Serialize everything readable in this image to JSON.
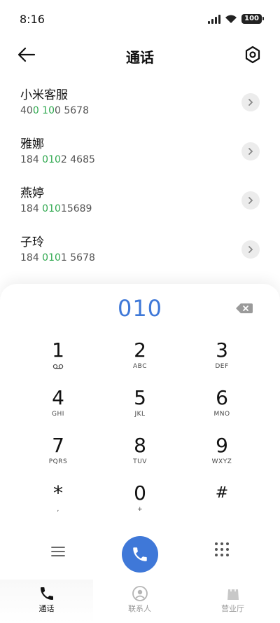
{
  "status_bar": {
    "time": "8:16",
    "battery": "100"
  },
  "header": {
    "title": "通话",
    "back_icon": "arrow-left-icon",
    "settings_icon": "gear-hexagon-icon"
  },
  "contacts": [
    {
      "name": "小米客服",
      "number_parts": [
        "40",
        "0 10",
        "0 5678"
      ]
    },
    {
      "name": "雅娜",
      "number_parts": [
        "184 ",
        "010",
        "2 4685"
      ]
    },
    {
      "name": "燕婷",
      "number_parts": [
        "184 ",
        "010",
        "15689"
      ]
    },
    {
      "name": "子玲",
      "number_parts": [
        "184 ",
        "010",
        "1 5678"
      ]
    }
  ],
  "colors": {
    "accent": "#3f78d8",
    "match_highlight": "#2fa84f"
  },
  "dialer": {
    "input_value": "010",
    "keys": [
      {
        "digit": "1",
        "sub": "voicemail-icon"
      },
      {
        "digit": "2",
        "sub": "ABC"
      },
      {
        "digit": "3",
        "sub": "DEF"
      },
      {
        "digit": "4",
        "sub": "GHI"
      },
      {
        "digit": "5",
        "sub": "JKL"
      },
      {
        "digit": "6",
        "sub": "MNO"
      },
      {
        "digit": "7",
        "sub": "PQRS"
      },
      {
        "digit": "8",
        "sub": "TUV"
      },
      {
        "digit": "9",
        "sub": "WXYZ"
      },
      {
        "digit": "*",
        "sub": ","
      },
      {
        "digit": "0",
        "sub": "+"
      },
      {
        "digit": "#",
        "sub": ""
      }
    ]
  },
  "tabs": [
    {
      "label": "通话",
      "icon": "phone-icon",
      "active": true
    },
    {
      "label": "联系人",
      "icon": "contact-person-icon",
      "active": false
    },
    {
      "label": "营业厅",
      "icon": "shopping-bag-icon",
      "active": false
    }
  ]
}
